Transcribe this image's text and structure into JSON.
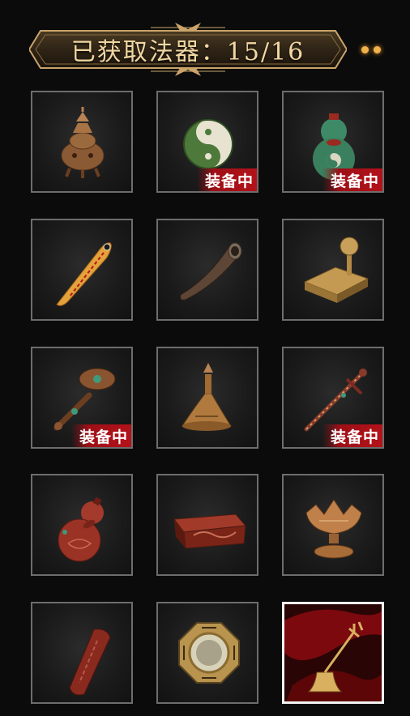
{
  "header": {
    "title": "已获取法器：15/16"
  },
  "colors": {
    "accent_gold": "#d8b27a",
    "badge_red": "#b3121a",
    "slot_border": "#6d6d6d",
    "selected_border": "#f2f2f2"
  },
  "grid": {
    "items": [
      {
        "name": "bronze-censer",
        "icon": "censer-icon",
        "equipped": false,
        "badge": ""
      },
      {
        "name": "jade-taiji-pendant",
        "icon": "taiji-pendant-icon",
        "equipped": true,
        "badge": "装备中"
      },
      {
        "name": "jade-gourd",
        "icon": "jade-gourd-icon",
        "equipped": true,
        "badge": "装备中"
      },
      {
        "name": "talisman-scroll",
        "icon": "talisman-icon",
        "equipped": false,
        "badge": ""
      },
      {
        "name": "ox-horn",
        "icon": "horn-icon",
        "equipped": false,
        "badge": ""
      },
      {
        "name": "seal-stamp",
        "icon": "seal-icon",
        "equipped": false,
        "badge": ""
      },
      {
        "name": "ruyi-scepter",
        "icon": "ruyi-icon",
        "equipped": true,
        "badge": "装备中"
      },
      {
        "name": "bronze-bell",
        "icon": "bell-icon",
        "equipped": false,
        "badge": ""
      },
      {
        "name": "coin-sword",
        "icon": "coin-sword-icon",
        "equipped": true,
        "badge": "装备中"
      },
      {
        "name": "red-gourd",
        "icon": "red-gourd-icon",
        "equipped": false,
        "badge": ""
      },
      {
        "name": "carved-wood-block",
        "icon": "wood-block-icon",
        "equipped": false,
        "badge": ""
      },
      {
        "name": "lotus-lamp",
        "icon": "lotus-lamp-icon",
        "equipped": false,
        "badge": ""
      },
      {
        "name": "command-token",
        "icon": "token-icon",
        "equipped": false,
        "badge": ""
      },
      {
        "name": "bagua-mirror",
        "icon": "bagua-mirror-icon",
        "equipped": false,
        "badge": ""
      },
      {
        "name": "trident-bell",
        "icon": "trident-bell-icon",
        "equipped": false,
        "badge": "",
        "selected": true
      }
    ]
  }
}
